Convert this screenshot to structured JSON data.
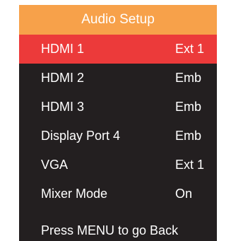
{
  "menu": {
    "title": "Audio Setup",
    "items": [
      {
        "label": "HDMI 1",
        "value": "Ext 1",
        "selected": true
      },
      {
        "label": "HDMI 2",
        "value": "Emb",
        "selected": false
      },
      {
        "label": "HDMI 3",
        "value": "Emb",
        "selected": false
      },
      {
        "label": "Display Port 4",
        "value": "Emb",
        "selected": false
      },
      {
        "label": "VGA",
        "value": "Ext 1",
        "selected": false
      },
      {
        "label": "Mixer Mode",
        "value": "On",
        "selected": false
      }
    ],
    "footer": "Press MENU to go Back"
  },
  "colors": {
    "header_bg": "#f7a14a",
    "menu_bg": "#231f20",
    "selected_bg": "#ec3a3a",
    "text": "#ffffff"
  }
}
